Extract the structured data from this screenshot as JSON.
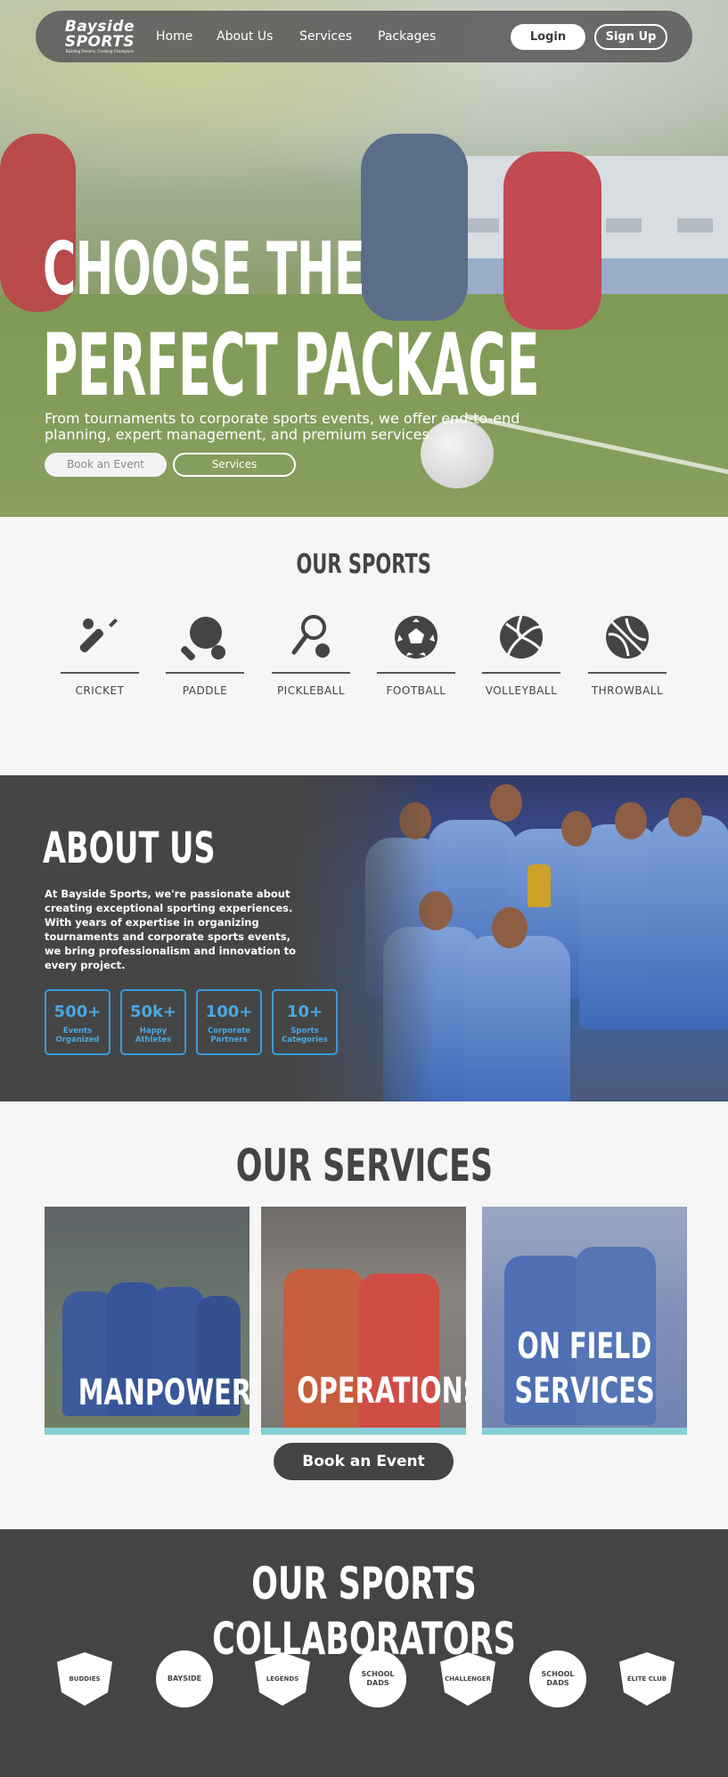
{
  "nav": {
    "logo_line1": "Bayside",
    "logo_line2": "SPORTS",
    "logo_tagline": "Building Dreams, Creating Champions",
    "links": [
      "Home",
      "About Us",
      "Services",
      "Packages"
    ],
    "login_label": "Login",
    "signup_label": "Sign Up"
  },
  "hero": {
    "title_line1": "CHOOSE THE",
    "title_line2": "PERFECT PACKAGE",
    "subtitle": "From tournaments to corporate sports events, we offer end-to-end planning, expert management, and premium services.",
    "primary_button": "Book an Event",
    "secondary_button": "Services"
  },
  "sports": {
    "title": "OUR SPORTS",
    "items": [
      {
        "name": "CRICKET",
        "icon": "cricket-icon"
      },
      {
        "name": "PADDLE",
        "icon": "paddle-icon"
      },
      {
        "name": "PICKLEBALL",
        "icon": "pickleball-icon"
      },
      {
        "name": "FOOTBALL",
        "icon": "football-icon"
      },
      {
        "name": "VOLLEYBALL",
        "icon": "volleyball-icon"
      },
      {
        "name": "THROWBALL",
        "icon": "throwball-icon"
      }
    ]
  },
  "about": {
    "title": "ABOUT US",
    "text": "At Bayside Sports, we're passionate about creating exceptional sporting experiences. With years of expertise in organizing tournaments and corporate sports events, we bring professionalism and innovation to every project.",
    "stats": [
      {
        "value": "500+",
        "label_line1": "Events",
        "label_line2": "Organized"
      },
      {
        "value": "50k+",
        "label_line1": "Happy",
        "label_line2": "Athletes"
      },
      {
        "value": "100+",
        "label_line1": "Corporate",
        "label_line2": "Partners"
      },
      {
        "value": "10+",
        "label_line1": "Sports",
        "label_line2": "Categories"
      }
    ]
  },
  "services": {
    "title": "OUR SERVICES",
    "cards": [
      {
        "label_line1": "",
        "label_line2": "MANPOWER"
      },
      {
        "label_line1": "",
        "label_line2": "OPERATIONS"
      },
      {
        "label_line1": "ON FIELD",
        "label_line2": "SERVICES"
      }
    ],
    "book_button": "Book an Event"
  },
  "collaborators": {
    "title": "OUR SPORTS COLLABORATORS",
    "logos": [
      "BUDDIES",
      "BAYSIDE",
      "LEGENDS",
      "SCHOOL DADS",
      "CHALLENGER",
      "SCHOOL DADS",
      "ELITE CLUB"
    ]
  },
  "colors": {
    "accent": "#4aa8e0",
    "dark": "#444444",
    "underline": "#86cfd6"
  }
}
